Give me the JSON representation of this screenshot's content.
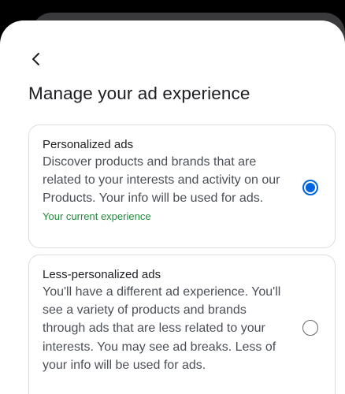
{
  "header": {
    "back_icon": "chevron-left-icon",
    "title": "Manage your ad experience"
  },
  "options": [
    {
      "title": "Personalized ads",
      "description": "Discover products and brands that are related to your interests and activity on our Products. Your info will be used for ads.",
      "status": "Your current experience",
      "selected": true
    },
    {
      "title": "Less-personalized ads",
      "description": "You'll have a different ad experience. You'll see a variety of products and brands through ads that are less related to your interests. You may see ad breaks. Less of your info will be used for ads.",
      "selected": false
    }
  ],
  "colors": {
    "accent": "#0064e0",
    "status_green": "#1e8b3a",
    "backdrop": "#000000",
    "border": "#dadde1"
  }
}
